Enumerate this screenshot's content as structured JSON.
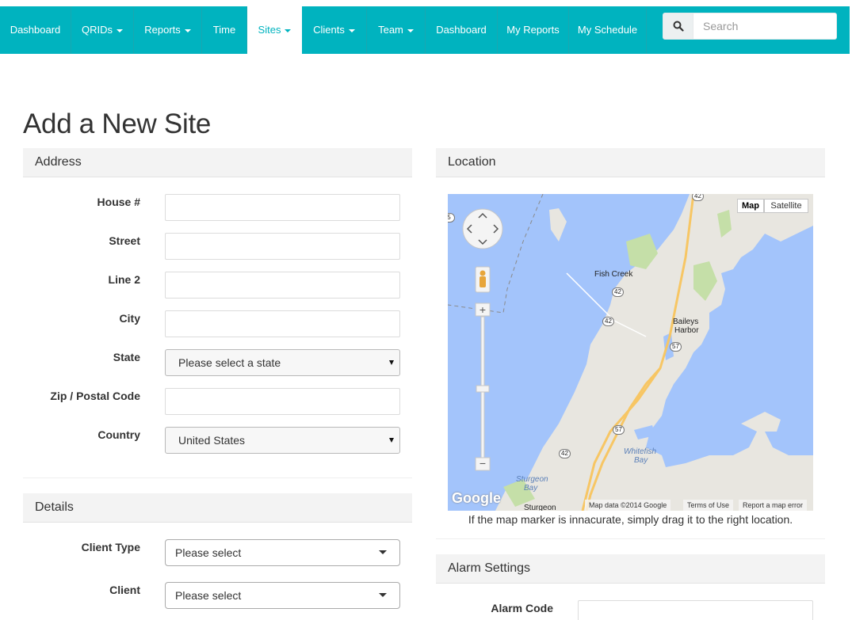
{
  "nav": {
    "items": [
      {
        "label": "Dashboard",
        "caret": false
      },
      {
        "label": "QRIDs",
        "caret": true
      },
      {
        "label": "Reports",
        "caret": true
      },
      {
        "label": "Time",
        "caret": false
      },
      {
        "label": "Sites",
        "caret": true,
        "active": true
      },
      {
        "label": "Clients",
        "caret": true
      },
      {
        "label": "Team",
        "caret": true
      },
      {
        "label": "Dashboard",
        "caret": false
      },
      {
        "label": "My Reports",
        "caret": false
      },
      {
        "label": "My Schedule",
        "caret": false
      }
    ],
    "search_placeholder": "Search",
    "accent": "#00b3bf"
  },
  "page": {
    "title": "Add a New Site"
  },
  "address": {
    "heading": "Address",
    "house_label": "House #",
    "street_label": "Street",
    "line2_label": "Line 2",
    "city_label": "City",
    "state_label": "State",
    "state_value": "Please select a state",
    "zip_label": "Zip / Postal Code",
    "country_label": "Country",
    "country_value": "United States"
  },
  "details": {
    "heading": "Details",
    "client_type_label": "Client Type",
    "client_type_value": "Please select",
    "client_label": "Client",
    "client_value": "Please select"
  },
  "location": {
    "heading": "Location",
    "map": {
      "type_map": "Map",
      "type_satellite": "Satellite",
      "attribution": "Map data ©2014 Google",
      "terms": "Terms of Use",
      "report": "Report a map error",
      "logo": "Google",
      "places": {
        "fish_creek": "Fish Creek",
        "baileys_harbor_1": "Baileys",
        "baileys_harbor_2": "Harbor",
        "whitefish_bay_1": "Whitefish",
        "whitefish_bay_2": "Bay",
        "sturgeon_bay_1": "Sturgeon",
        "sturgeon_bay_2": "Bay",
        "sturgeon": "Sturgeon"
      },
      "routes": {
        "r42_top": "42",
        "r42_a": "42",
        "r42_b": "42",
        "r42_c": "42",
        "r57_a": "57",
        "r57_b": "57",
        "r5": "5"
      }
    },
    "note": "If the map marker is innacurate, simply drag it to the right location."
  },
  "alarm": {
    "heading": "Alarm Settings",
    "code_label": "Alarm Code"
  }
}
